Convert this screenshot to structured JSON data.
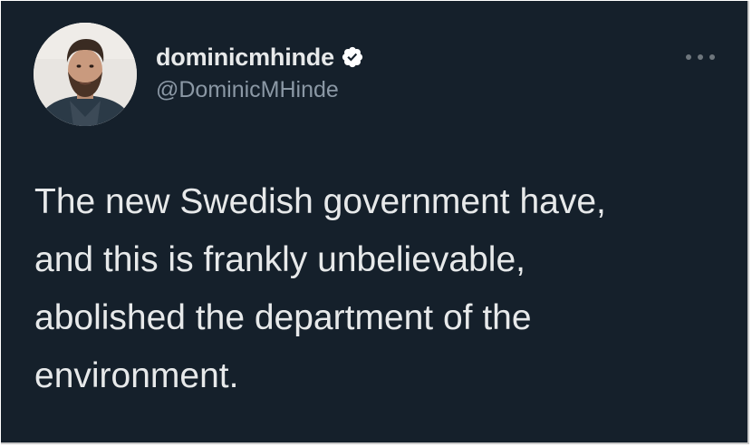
{
  "tweet": {
    "author": {
      "display_name": "dominicmhinde",
      "handle": "@DominicMHinde",
      "verified": true
    },
    "text_lines": [
      "The new Swedish government have,",
      "and this is frankly unbelievable,",
      "abolished the department of the",
      "environment."
    ]
  },
  "icons": {
    "verified": "verified-badge-icon",
    "more": "more-options-icon"
  },
  "colors": {
    "background": "#15202b",
    "primary_text": "#e7e9ea",
    "secondary_text": "#8b98a5",
    "verified_badge": "#ffffff"
  }
}
